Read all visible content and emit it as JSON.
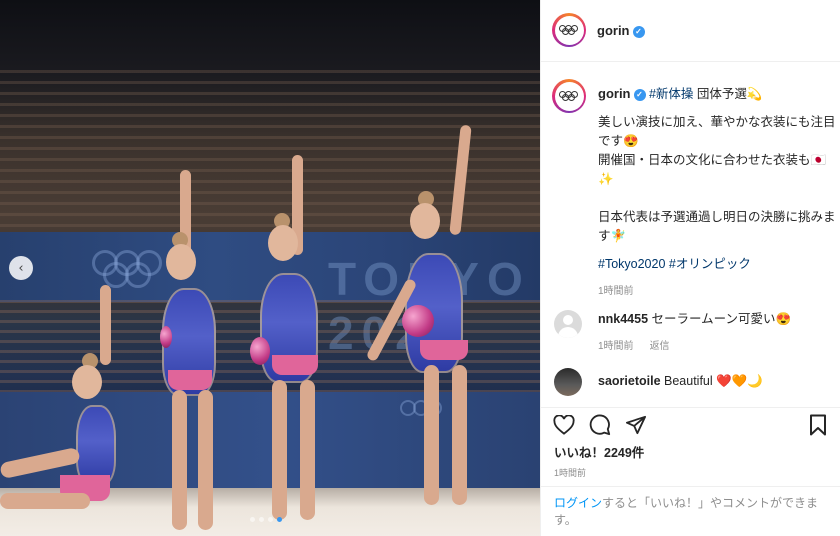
{
  "post": {
    "username": "gorin",
    "caption_tags_first": "#新体操",
    "caption_headline": "団体予選💫",
    "caption_line1": "美しい演技に加え、華やかな衣装にも注目",
    "caption_line2": "です😍",
    "caption_line3": "開催国・日本の文化に合わせた衣装も🇯🇵",
    "caption_line4": "✨",
    "caption_line5": "日本代表は予選通過し明日の決勝に挑みま",
    "caption_line6": "す🧚",
    "hashtag1": "#Tokyo2020",
    "hashtag2": "#オリンピック",
    "caption_time": "1時間前"
  },
  "comments": [
    {
      "username": "nnk4455",
      "text": "セーラームーン可愛い😍",
      "time": "1時間前",
      "reply": "返信"
    },
    {
      "username": "saorietoile",
      "text": "Beautiful ❤️🧡🌙"
    }
  ],
  "actions": {
    "like_icon": "heart-icon",
    "comment_icon": "comment-icon",
    "share_icon": "share-icon",
    "save_icon": "bookmark-icon",
    "likes_text": "いいね！2249件",
    "post_time": "1時間前"
  },
  "login_prompt": {
    "link": "ログイン",
    "rest": "すると「いいね！」やコメントができま",
    "rest2": "す。"
  },
  "photo": {
    "banner_text": "TOKYO 2020",
    "prev_arrow": "‹"
  },
  "colors": {
    "verified": "#3897f0",
    "hashtag": "#00376b",
    "heart": "#ed4956"
  }
}
